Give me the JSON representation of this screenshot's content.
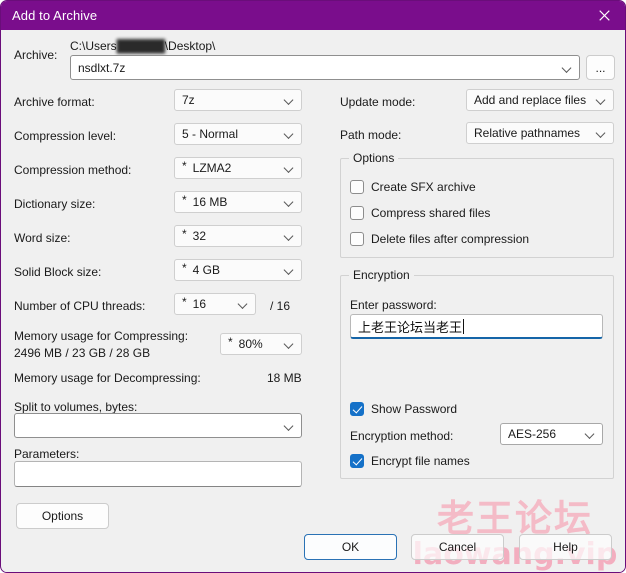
{
  "window": {
    "title": "Add to Archive",
    "close_icon": "close-icon"
  },
  "archive": {
    "label": "Archive:",
    "path_prefix": "C:\\Users",
    "path_user_redacted": "██████",
    "path_suffix": "\\Desktop\\",
    "filename": "nsdlxt.7z",
    "browse_label": "..."
  },
  "left": {
    "archive_format": {
      "label": "Archive format:",
      "value": "7z",
      "star": ""
    },
    "compression_level": {
      "label": "Compression level:",
      "value": "5 - Normal",
      "star": ""
    },
    "compression_method": {
      "label": "Compression method:",
      "value": "LZMA2",
      "star": "*"
    },
    "dictionary_size": {
      "label": "Dictionary size:",
      "value": "16 MB",
      "star": "*"
    },
    "word_size": {
      "label": "Word size:",
      "value": "32",
      "star": "*"
    },
    "solid_block_size": {
      "label": "Solid Block size:",
      "value": "4 GB",
      "star": "*"
    },
    "cpu_threads": {
      "label": "Number of CPU threads:",
      "value": "16",
      "star": "*",
      "total": "/ 16"
    },
    "memory_compress": {
      "label": "Memory usage for Compressing:",
      "values": "2496 MB / 23 GB / 28 GB",
      "percent": "80%",
      "star": "*"
    },
    "memory_decompress": {
      "label": "Memory usage for Decompressing:",
      "value": "18 MB"
    },
    "split_volumes": {
      "label": "Split to volumes, bytes:",
      "value": ""
    },
    "parameters": {
      "label": "Parameters:",
      "value": ""
    },
    "options_button": "Options"
  },
  "right": {
    "update_mode": {
      "label": "Update mode:",
      "value": "Add and replace files"
    },
    "path_mode": {
      "label": "Path mode:",
      "value": "Relative pathnames"
    },
    "options_group": {
      "title": "Options",
      "items": [
        {
          "label": "Create SFX archive",
          "checked": false
        },
        {
          "label": "Compress shared files",
          "checked": false
        },
        {
          "label": "Delete files after compression",
          "checked": false
        }
      ]
    },
    "encryption_group": {
      "title": "Encryption",
      "password_label": "Enter password:",
      "password_value": "上老王论坛当老王",
      "show_password": {
        "label": "Show Password",
        "checked": true
      },
      "encryption_method": {
        "label": "Encryption method:",
        "value": "AES-256"
      },
      "encrypt_file_names": {
        "label": "Encrypt file names",
        "checked": true
      }
    }
  },
  "buttons": {
    "ok": "OK",
    "cancel": "Cancel",
    "help": "Help"
  },
  "watermark": {
    "chinese": "老王论坛",
    "latin": "laowang.vip"
  },
  "colors": {
    "titlebar": "#7a0d8c",
    "accent": "#1571c8",
    "focus_underline": "#1565a8",
    "watermark": "#f5b7c4"
  }
}
